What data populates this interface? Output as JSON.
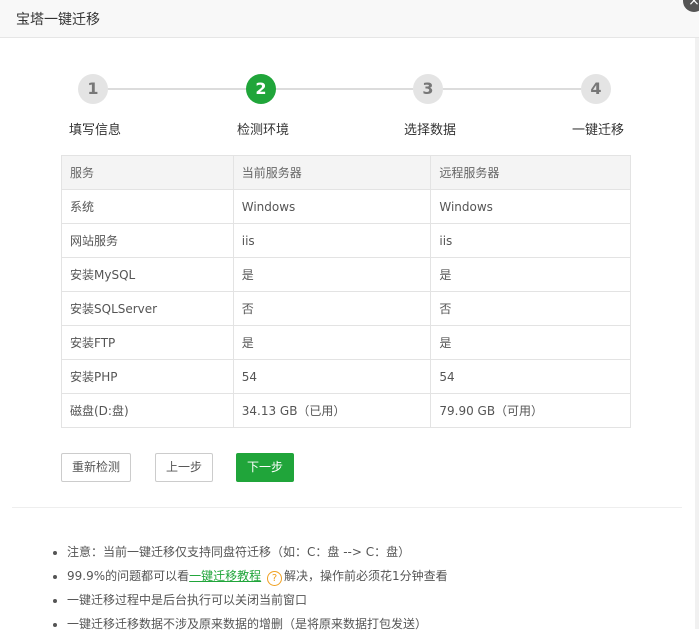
{
  "dialog": {
    "title": "宝塔一键迁移",
    "close_glyph": "×"
  },
  "steps": [
    {
      "number": "1",
      "label": "填写信息",
      "active": false
    },
    {
      "number": "2",
      "label": "检测环境",
      "active": true
    },
    {
      "number": "3",
      "label": "选择数据",
      "active": false
    },
    {
      "number": "4",
      "label": "一键迁移",
      "active": false
    }
  ],
  "table": {
    "headers": [
      "服务",
      "当前服务器",
      "远程服务器"
    ],
    "rows": [
      [
        "系统",
        "Windows",
        "Windows"
      ],
      [
        "网站服务",
        "iis",
        "iis"
      ],
      [
        "安装MySQL",
        "是",
        "是"
      ],
      [
        "安装SQLServer",
        "否",
        "否"
      ],
      [
        "安装FTP",
        "是",
        "是"
      ],
      [
        "安装PHP",
        "54",
        "54"
      ],
      [
        "磁盘(D:盘)",
        "34.13 GB（已用）",
        "79.90 GB（可用）"
      ]
    ]
  },
  "buttons": {
    "recheck": "重新检测",
    "prev": "上一步",
    "next": "下一步"
  },
  "notes": {
    "n1": "注意：当前一键迁移仅支持同盘符迁移（如：C：盘 --> C：盘）",
    "n2_prefix": "99.9%的问题都可以看",
    "n2_link": "一键迁移教程",
    "n2_icon": "?",
    "n2_suffix": "解决，操作前必须花1分钟查看",
    "n3": "一键迁移过程中是后台执行可以关闭当前窗口",
    "n4": "一键迁移迁移数据不涉及原来数据的增删（是将原来数据打包发送）"
  },
  "colors": {
    "accent": "#20a53a",
    "inactive_step": "#e4e4e4",
    "help_icon": "#f0a020"
  }
}
